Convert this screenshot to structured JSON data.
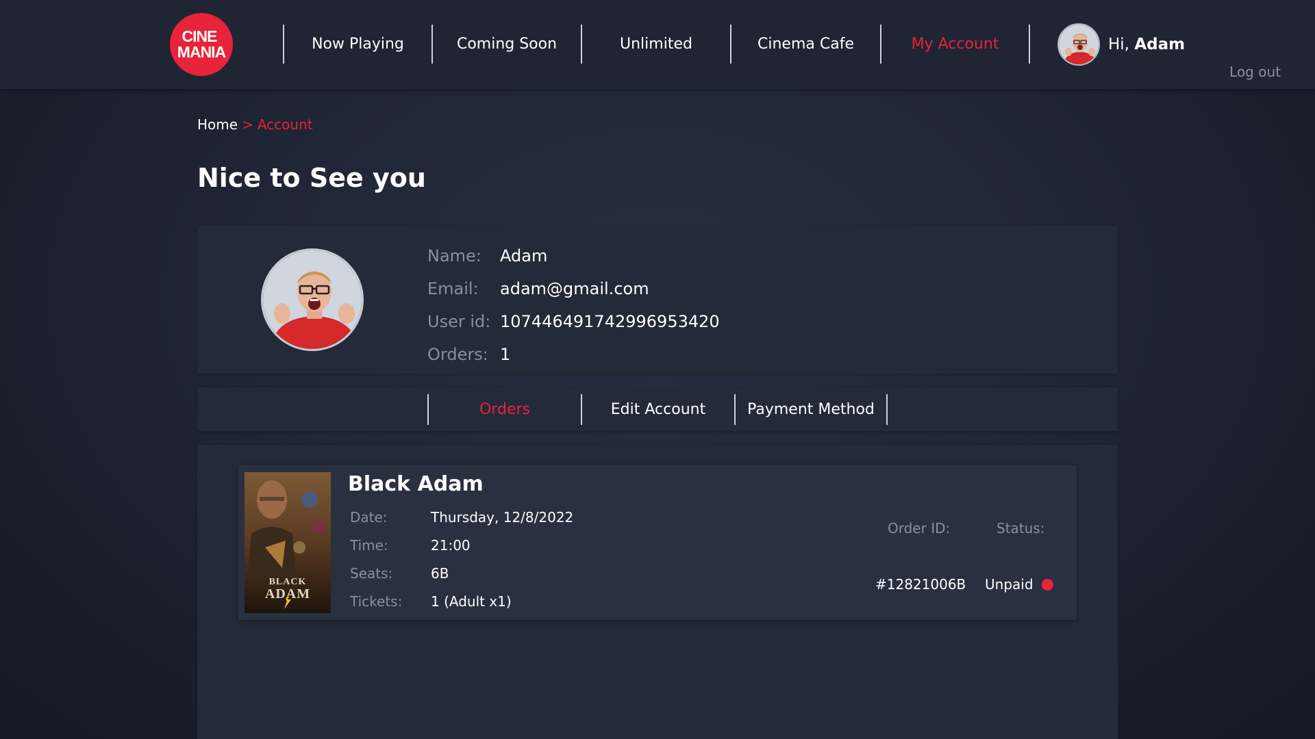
{
  "brand": {
    "logo_line1": "CINE",
    "logo_line2": "MANIA",
    "accent": "#e8233a"
  },
  "nav": {
    "items": [
      {
        "label": "Now Playing"
      },
      {
        "label": "Coming Soon"
      },
      {
        "label": "Unlimited"
      },
      {
        "label": "Cinema Cafe"
      },
      {
        "label": "My Account",
        "active": true
      }
    ],
    "greeting": "Hi,",
    "user_name": "Adam",
    "logout": "Log out"
  },
  "breadcrumb": {
    "home": "Home",
    "separator": ">",
    "current": "Account"
  },
  "page_title": "Nice to See you",
  "profile": {
    "rows": [
      {
        "key": "Name:",
        "value": "Adam"
      },
      {
        "key": "Email:",
        "value": "adam@gmail.com"
      },
      {
        "key": "User id:",
        "value": "107446491742996953420"
      },
      {
        "key": "Orders:",
        "value": "1"
      }
    ]
  },
  "tabs": [
    {
      "label": "Orders",
      "active": true
    },
    {
      "label": "Edit Account"
    },
    {
      "label": "Payment Method"
    }
  ],
  "order": {
    "title": "Black Adam",
    "poster_text": "BLACK ADAM",
    "details": [
      {
        "key": "Date:",
        "value": "Thursday, 12/8/2022"
      },
      {
        "key": "Time:",
        "value": "21:00"
      },
      {
        "key": "Seats:",
        "value": "6B"
      },
      {
        "key": "Tickets:",
        "value": "1 (Adult x1)"
      }
    ],
    "order_id_label": "Order ID:",
    "status_label": "Status:",
    "order_id": "#12821006B",
    "status": "Unpaid",
    "status_color": "#e8233a"
  }
}
